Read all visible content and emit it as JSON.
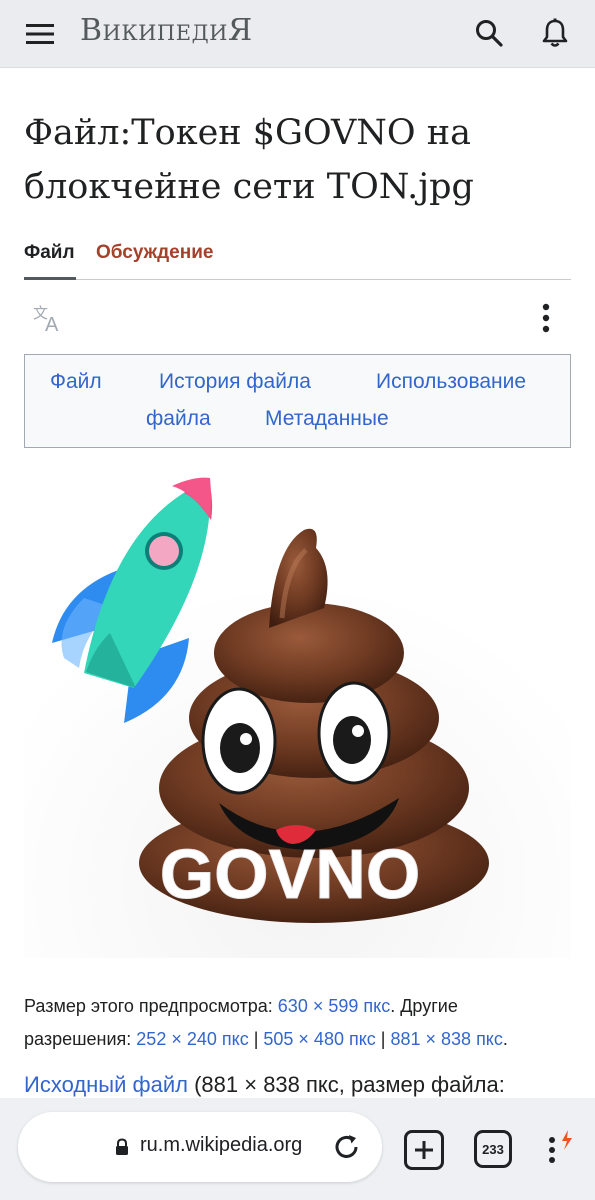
{
  "header": {
    "brand": "ВикипедиЯ",
    "menu_icon": "hamburger-icon",
    "search_icon": "search-icon",
    "notifications_icon": "bell-icon"
  },
  "page": {
    "title": "Файл:Токен $GOVNO на блокчейне сети TON.jpg"
  },
  "tabs": [
    {
      "label": "Файл",
      "active": true
    },
    {
      "label": "Обсуждение",
      "active": false
    }
  ],
  "toolbar": {
    "language_icon": "translate-icon",
    "more_icon": "vertical-ellipsis-icon"
  },
  "file_nav": {
    "links": [
      "Файл",
      "История файла",
      "Использование",
      "файла",
      "Метаданные"
    ]
  },
  "image": {
    "caption_text": "GOVNO"
  },
  "info": {
    "preview_label": "Размер этого предпросмотра: ",
    "preview_size": "630 × 599 пкс",
    "other_label": ". Другие",
    "other_label2": "разрешения: ",
    "res1": "252 × 240 пкс",
    "sep": " | ",
    "res2": "505 × 480 пкс",
    "res3": "881 × 838 пкс",
    "period": "."
  },
  "original": {
    "link": "Исходный файл",
    "details": " (881 × 838 пкс, размер файла:"
  },
  "browser": {
    "url": "ru.m.wikipedia.org",
    "tab_count": "233",
    "lock_icon": "lock-icon",
    "reload_icon": "reload-icon",
    "new_tab_icon": "plus-icon",
    "menu_icon": "vertical-ellipsis-icon",
    "accent": "#f4511e"
  },
  "colors": {
    "link": "#3366cc",
    "talk_tab": "#a6402c",
    "header_bg": "#eaecf0"
  }
}
